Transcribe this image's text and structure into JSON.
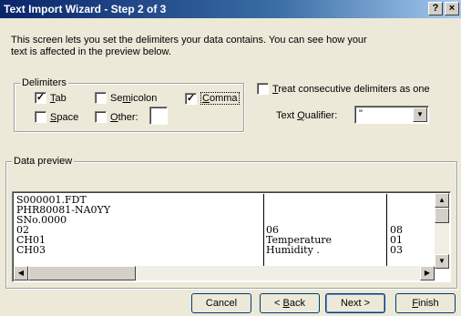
{
  "window": {
    "title": "Text Import Wizard - Step 2 of 3",
    "help_btn": "?",
    "close_btn": "×"
  },
  "intro": "This screen lets you set the delimiters your data contains.  You can see how your text is affected in the preview below.",
  "delimiters": {
    "legend": "Delimiters",
    "tab": {
      "label_pre": "",
      "accel": "T",
      "label_post": "ab",
      "checked": true
    },
    "semicolon": {
      "label_pre": "Se",
      "accel": "m",
      "label_post": "icolon",
      "checked": false
    },
    "comma": {
      "label_pre": "",
      "accel": "C",
      "label_post": "omma",
      "checked": true
    },
    "space": {
      "label_pre": "",
      "accel": "S",
      "label_post": "pace",
      "checked": false
    },
    "other": {
      "label_pre": "",
      "accel": "O",
      "label_post": "ther:",
      "checked": false,
      "value": ""
    }
  },
  "consecutive": {
    "label_pre": "",
    "accel": "T",
    "label_post": "reat consecutive delimiters as one",
    "checked": false
  },
  "qualifier": {
    "label_pre": "Text ",
    "accel": "Q",
    "label_post": "ualifier:",
    "value": "\""
  },
  "preview": {
    "legend": "Data preview",
    "rows": [
      [
        "S000001.FDT",
        "",
        ""
      ],
      [
        "PHR80081-NA0YY",
        "",
        ""
      ],
      [
        "SNo.0000",
        "",
        ""
      ],
      [
        "02",
        "06",
        "08"
      ],
      [
        "CH01",
        "Temperature",
        "01"
      ],
      [
        "CH03",
        "Humidity  .",
        "03"
      ]
    ]
  },
  "buttons": {
    "cancel": "Cancel",
    "back": {
      "pre": "< ",
      "accel": "B",
      "post": "ack"
    },
    "next": "Next >",
    "finish": {
      "pre": "",
      "accel": "F",
      "post": "inish"
    }
  },
  "colors": {
    "title_bg": "#0a246a",
    "face": "#ece9d8"
  }
}
